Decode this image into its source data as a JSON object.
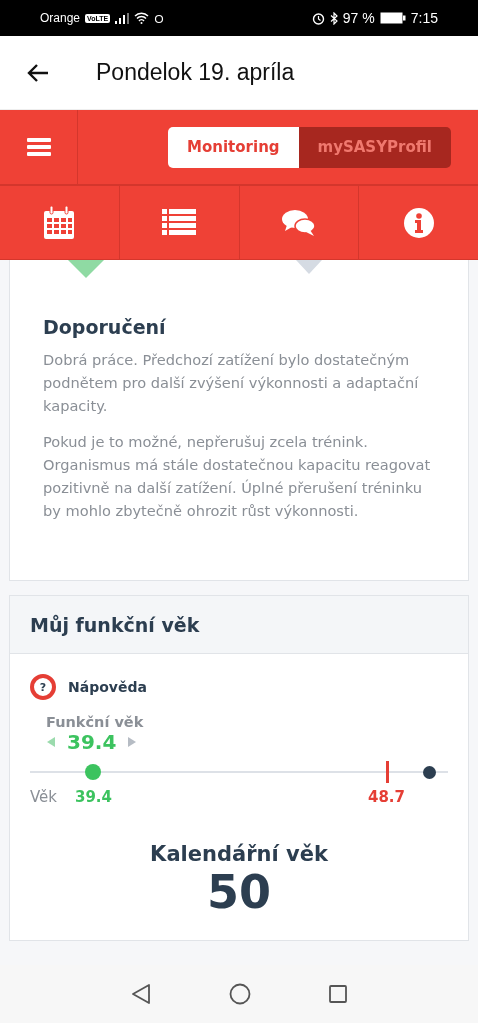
{
  "status_bar": {
    "carrier": "Orange",
    "volte": "VoLTE",
    "battery": "97 %",
    "time": "7:15"
  },
  "app_bar": {
    "title": "Pondelok 19. apríla"
  },
  "segments": [
    {
      "label": "Monitoring",
      "selected": true
    },
    {
      "label": "mySASYProfil",
      "selected": false
    }
  ],
  "icon_tabs": [
    {
      "kind": "calendar"
    },
    {
      "kind": "list"
    },
    {
      "kind": "chat"
    },
    {
      "kind": "info"
    }
  ],
  "recommendation": {
    "title": "Doporučení",
    "paragraphs": [
      "Dobrá práce. Předchozí zatížení bylo dostatečným podnětem pro další zvýšení výkonnosti a adaptační kapacity.",
      "Pokud je to možné, nepřerušuj zcela trénink. Organismus má stále dostatečnou kapacitu reagovat pozitivně na další zatížení. Úplné přerušení tréninku by mohlo zbytečně ohrozit růst výkonnosti."
    ]
  },
  "functional_age": {
    "title": "Můj funkční věk",
    "help_icon": "?",
    "help": "Nápověda",
    "label": "Funkční věk",
    "value": "39.4",
    "age_label": "Věk",
    "markers": [
      {
        "kind": "thumb",
        "level": 0.15
      },
      {
        "kind": "limit",
        "level": 0.855
      },
      {
        "kind": "end",
        "level": 0.955
      }
    ],
    "scale_values": [
      "39.4",
      "48.7"
    ],
    "calendar_label": "Kalendářní věk",
    "calendar_value": "50"
  }
}
